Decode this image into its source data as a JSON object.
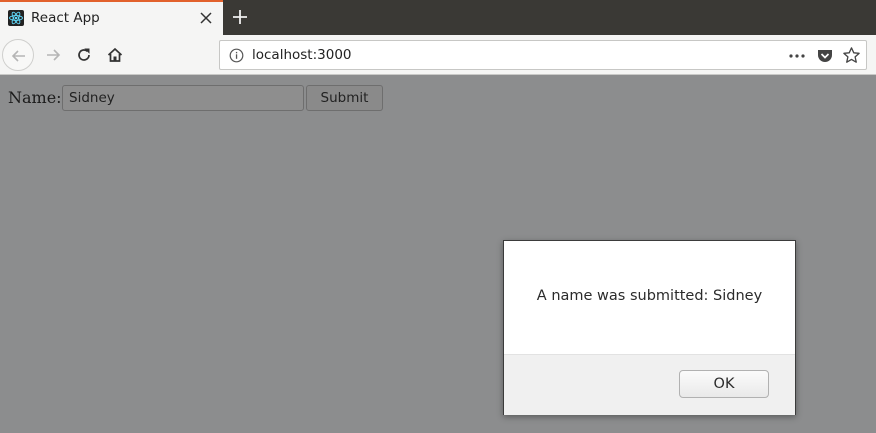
{
  "browser": {
    "tab": {
      "title": "React App",
      "favicon": "react-logo-icon"
    },
    "url": "localhost:3000",
    "colors": {
      "tab_accent": "#e2612c",
      "tabbar_bg": "#3a3935",
      "toolbar_bg": "#f5f5f4"
    }
  },
  "form": {
    "label": "Name:",
    "input_value": "Sidney",
    "submit_label": "Submit"
  },
  "alert": {
    "message": "A name was submitted: Sidney",
    "ok_label": "OK"
  },
  "page_overlay_color": "#8c8d8e"
}
